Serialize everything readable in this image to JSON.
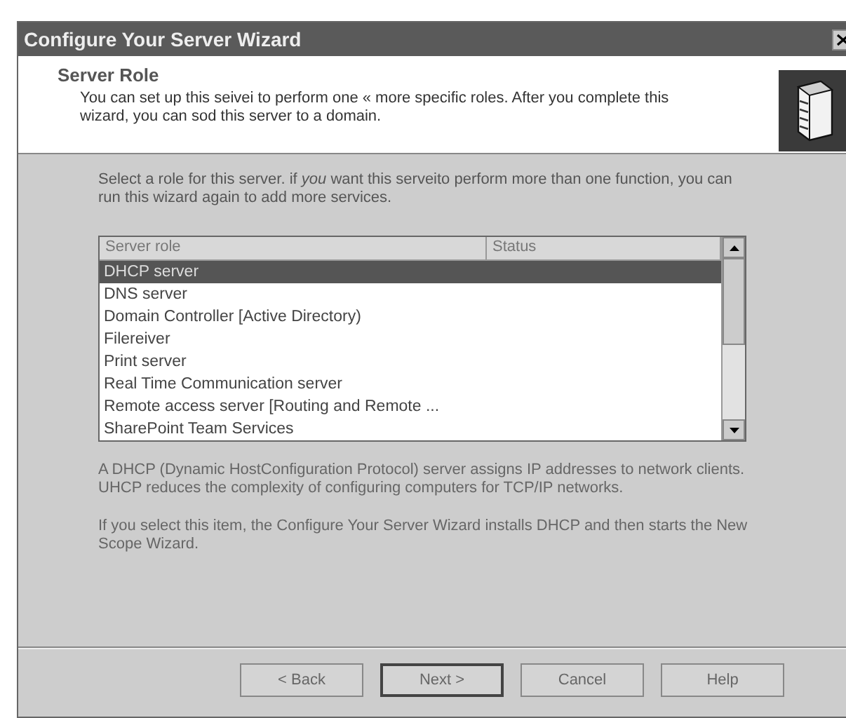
{
  "window": {
    "title": "Configure Your Server Wizard"
  },
  "header": {
    "title": "Server Role",
    "description": "You can set up this seivei to perform one « more specific roles. After you complete this wizard, you can sod this server to a domain."
  },
  "instruction": "Select a role for this server. if *you* want this serveito perform more than one function, you can run this wizard again to add more services.",
  "table": {
    "columns": [
      "Server role",
      "Status"
    ],
    "rows": [
      {
        "role": "DHCP server",
        "selected": true
      },
      {
        "role": "DNS server",
        "selected": false
      },
      {
        "role": "Domain Controller [Active Directory)",
        "selected": false
      },
      {
        "role": "Filereiver",
        "selected": false
      },
      {
        "role": "Print server",
        "selected": false
      },
      {
        "role": "Real Time Communication server",
        "selected": false
      },
      {
        "role": "Remote access server [Routing and Remote ...",
        "selected": false
      },
      {
        "role": "SharePoint Team Services",
        "selected": false
      }
    ]
  },
  "details": [
    "A DHCP (Dynamic HostConfiguration Protocol) server assigns IP addresses to network clients. UHCP reduces the complexity of configuring computers for TCP/IP networks.",
    "If you select this item, the Configure Your Server Wizard installs DHCP and then starts the New Scope Wizard."
  ],
  "buttons": [
    {
      "label": "< Back",
      "default": false
    },
    {
      "label": "Next >",
      "default": true
    },
    {
      "label": "Cancel",
      "default": false
    },
    {
      "label": "Help",
      "default": false
    }
  ]
}
